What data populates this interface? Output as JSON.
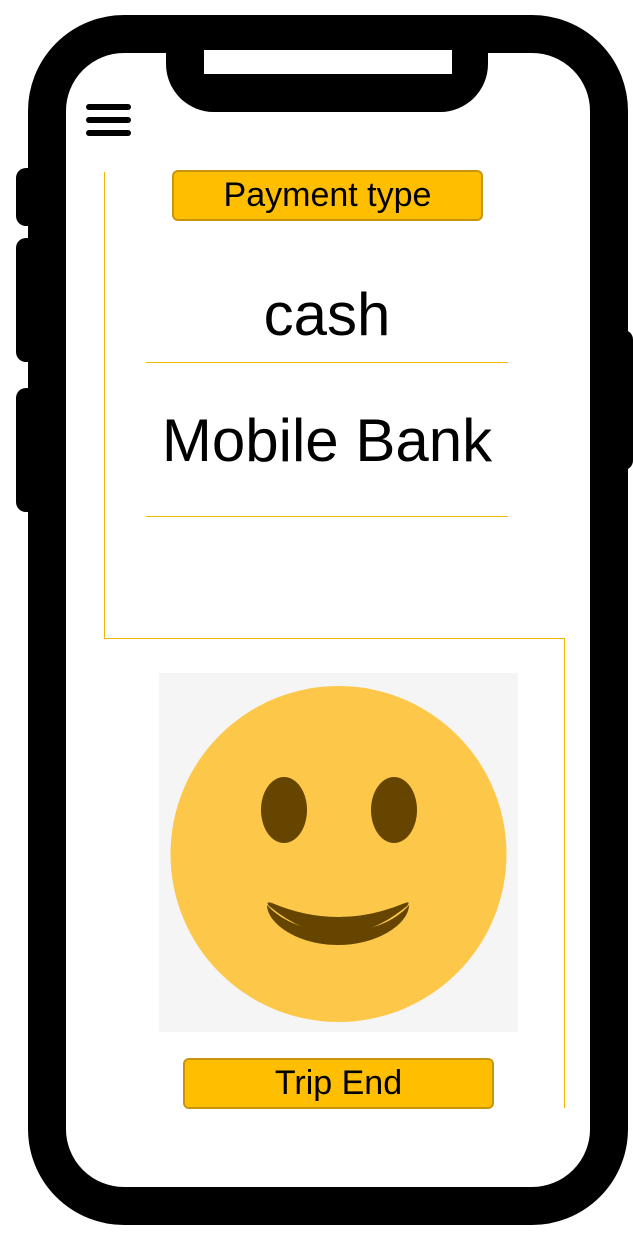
{
  "header": {
    "menu_icon": "hamburger-icon"
  },
  "payment": {
    "title": "Payment type",
    "options": [
      "cash",
      "Mobile Bank"
    ]
  },
  "illustration": {
    "icon": "smiling-face-icon"
  },
  "actions": {
    "trip_end_label": "Trip End"
  },
  "colors": {
    "accent": "#ffbf00",
    "accent_border": "#c9960b",
    "divider": "#f2b600",
    "emoji_face": "#fdc84a",
    "emoji_features": "#664500"
  }
}
